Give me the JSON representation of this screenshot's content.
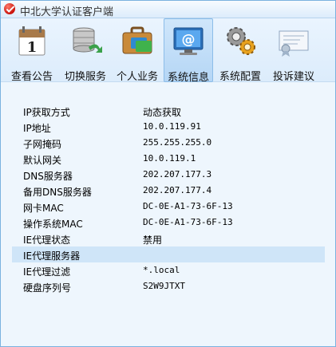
{
  "window": {
    "title": "中北大学认证客户端"
  },
  "toolbar": {
    "buttons": [
      {
        "label": "查看公告",
        "icon": "calendar-icon"
      },
      {
        "label": "切换服务",
        "icon": "server-switch-icon"
      },
      {
        "label": "个人业务",
        "icon": "briefcase-icon"
      },
      {
        "label": "系统信息",
        "icon": "email-monitor-icon",
        "active": true
      },
      {
        "label": "系统配置",
        "icon": "gears-icon"
      },
      {
        "label": "投诉建议",
        "icon": "certificate-icon"
      }
    ]
  },
  "info": {
    "rows": [
      {
        "label": "IP获取方式",
        "value": "动态获取"
      },
      {
        "label": "IP地址",
        "value": "10.0.119.91"
      },
      {
        "label": "子网掩码",
        "value": "255.255.255.0"
      },
      {
        "label": "默认网关",
        "value": "10.0.119.1"
      },
      {
        "label": "DNS服务器",
        "value": "202.207.177.3"
      },
      {
        "label": "备用DNS服务器",
        "value": "202.207.177.4"
      },
      {
        "label": "网卡MAC",
        "value": "DC-0E-A1-73-6F-13"
      },
      {
        "label": "操作系统MAC",
        "value": "DC-0E-A1-73-6F-13"
      },
      {
        "label": "IE代理状态",
        "value": "禁用"
      },
      {
        "label": "IE代理服务器",
        "value": "",
        "highlighted": true
      },
      {
        "label": "IE代理过滤",
        "value": "*.local"
      },
      {
        "label": "硬盘序列号",
        "value": "S2W9JTXT"
      }
    ]
  }
}
